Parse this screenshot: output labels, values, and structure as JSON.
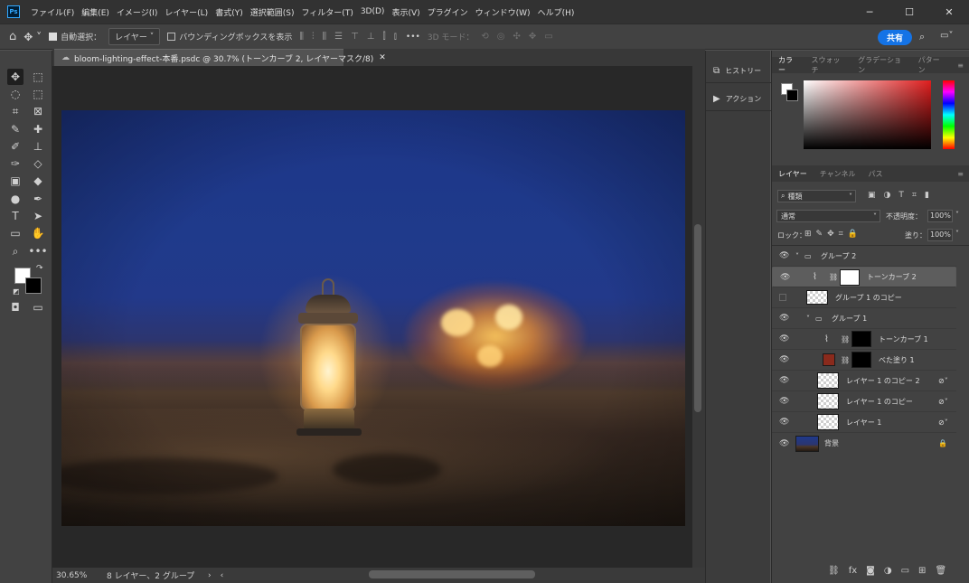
{
  "app": {
    "logo": "Ps"
  },
  "menu": [
    "ファイル(F)",
    "編集(E)",
    "イメージ(I)",
    "レイヤー(L)",
    "書式(Y)",
    "選択範囲(S)",
    "フィルター(T)",
    "3D(D)",
    "表示(V)",
    "プラグイン",
    "ウィンドウ(W)",
    "ヘルプ(H)"
  ],
  "window_controls": {
    "minimize": "─",
    "maximize": "☐",
    "close": "✕"
  },
  "options": {
    "auto_select_label": "自動選択：",
    "auto_select_value": "レイヤー",
    "bbox_label": "バウンディングボックスを表示",
    "more": "•••",
    "mode_3d": "3D モード：",
    "share": "共有"
  },
  "document": {
    "tab_title": "bloom-lighting-effect-本番.psdc @ 30.7% (トーンカーブ 2, レイヤーマスク/8)",
    "zoom": "30.65%",
    "info": "8 レイヤー、2 グループ"
  },
  "mid_panel": {
    "history": "ヒストリー",
    "actions": "アクション"
  },
  "color_panel": {
    "tabs": [
      "カラー",
      "スウォッチ",
      "グラデーション",
      "パターン"
    ]
  },
  "layers_panel": {
    "tabs": [
      "レイヤー",
      "チャンネル",
      "パス"
    ],
    "filter_kind": "種類",
    "blend_mode": "通常",
    "opacity_label": "不透明度：",
    "opacity_value": "100%",
    "lock_label": "ロック：",
    "fill_label": "塗り：",
    "fill_value": "100%",
    "layers": [
      {
        "name": "グループ 2",
        "type": "group"
      },
      {
        "name": "トーンカーブ 2",
        "type": "curves"
      },
      {
        "name": "グループ 1 のコピー",
        "type": "layer"
      },
      {
        "name": "グループ 1",
        "type": "group"
      },
      {
        "name": "トーンカーブ 1",
        "type": "curves"
      },
      {
        "name": "べた塗り 1",
        "type": "fill"
      },
      {
        "name": "レイヤー 1 のコピー 2",
        "type": "smart"
      },
      {
        "name": "レイヤー 1 のコピー",
        "type": "smart"
      },
      {
        "name": "レイヤー 1",
        "type": "smart"
      },
      {
        "name": "背景",
        "type": "background"
      }
    ]
  },
  "colors": {
    "accent": "#1473e6",
    "panel": "#424242",
    "menubar": "#323232"
  }
}
